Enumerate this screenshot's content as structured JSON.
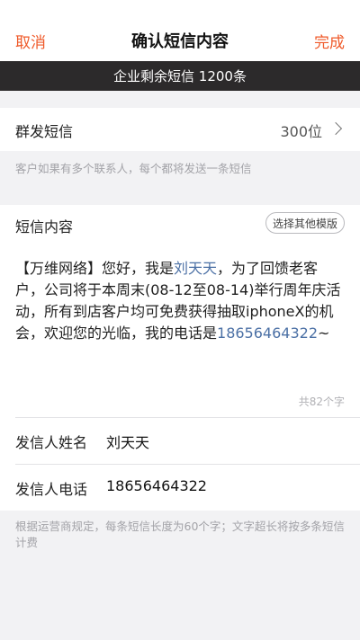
{
  "nav": {
    "cancel_label": "取消",
    "title": "确认短信内容",
    "done_label": "完成"
  },
  "quota_text": "企业剩余短信 1200条",
  "group_send": {
    "label": "群发短信",
    "value": "300位",
    "hint": "客户如果有多个联系人，每个都将发送一条短信"
  },
  "message": {
    "heading": "短信内容",
    "template_button": "选择其他模版",
    "body_part1": "【万维网络】您好，我是",
    "body_name": "刘天天",
    "body_part2": "，为了回馈老客户，公司将于本周末(08-12至08-14)举行周年庆活动，所有到店客户均可免费获得抽取iphoneX的机会，欢迎您的光临，我的电话是",
    "body_phone": "18656464322",
    "body_part3": "~",
    "char_count": "共82个字"
  },
  "sender": {
    "name_label": "发信人姓名",
    "name_value": "刘天天",
    "phone_label": "发信人电话",
    "phone_value": "18656464322"
  },
  "footer_hint": "根据运营商规定，每条短信长度为60个字；文字超长将按多条短信计费",
  "colors": {
    "accent": "#ef5a2a",
    "highlight": "#4b70a5",
    "quota_bar": "#2c2a2b"
  }
}
